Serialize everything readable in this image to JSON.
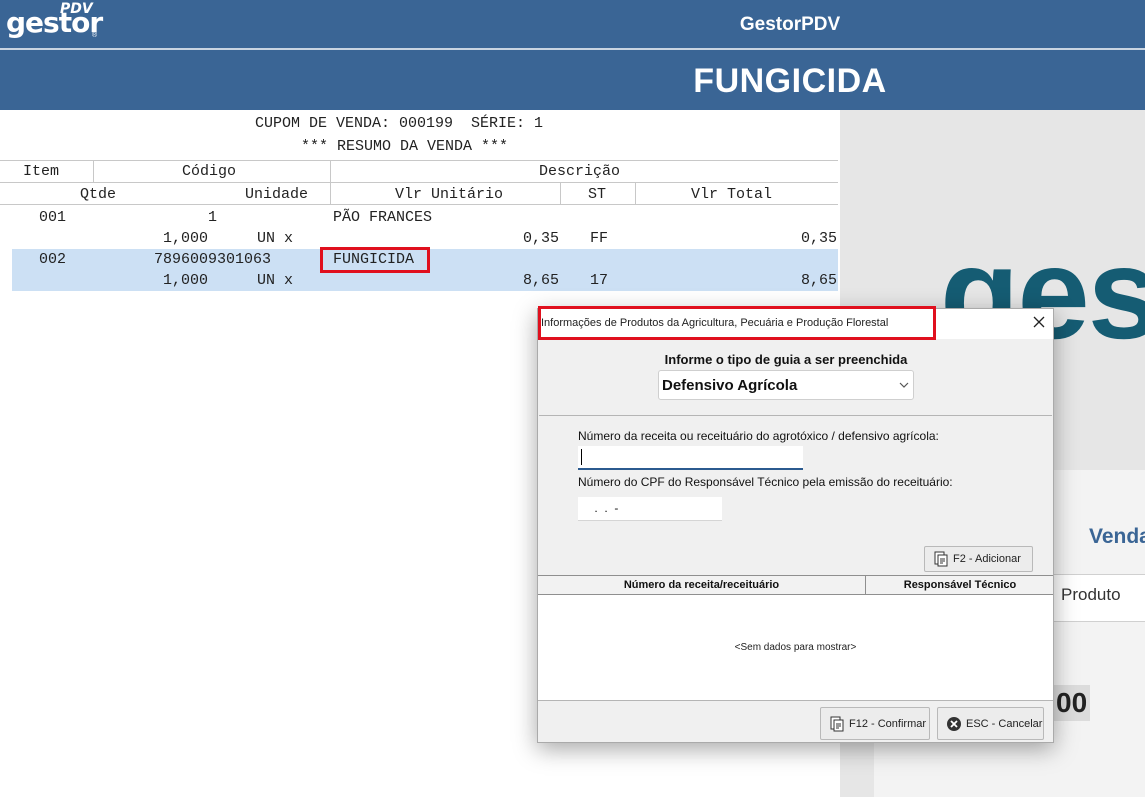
{
  "header": {
    "logo_text": "gestor",
    "logo_sub": "PDV",
    "app_title": "GestorPDV",
    "product_title": "FUNGICIDA"
  },
  "receipt": {
    "line1": "CUPOM DE VENDA: 000199  SÉRIE: 1",
    "line2": "*** RESUMO DA VENDA ***",
    "col_item": "Item",
    "col_codigo": "Código",
    "col_descricao": "Descrição",
    "col_qtde": "Qtde",
    "col_unidade": "Unidade",
    "col_vlr_unitario": "Vlr Unitário",
    "col_st": "ST",
    "col_vlr_total": "Vlr Total",
    "items": [
      {
        "item": "001",
        "codigo": "1",
        "descricao": "PÃO FRANCES",
        "qtde": "1,000",
        "unidade": "UN x",
        "vlr_unitario": "0,35",
        "st": "FF",
        "vlr_total": "0,35"
      },
      {
        "item": "002",
        "codigo": "7896009301063",
        "descricao": "FUNGICIDA",
        "qtde": "1,000",
        "unidade": "UN x",
        "vlr_unitario": "8,65",
        "st": "17",
        "vlr_total": "8,65"
      }
    ]
  },
  "right_panel": {
    "logo_text": "ges",
    "venda_label": "Venda",
    "produto_label": "Produto",
    "total_fragment": "00"
  },
  "dialog": {
    "title": "Informações de Produtos da Agricultura, Pecuária e Produção Florestal",
    "guide_prompt": "Informe o tipo de guia a ser preenchida",
    "guide_selected": "Defensivo Agrícola",
    "receita_label": "Número da receita ou receituário do agrotóxico / defensivo agrícola:",
    "receita_value": "",
    "cpf_label": "Número do CPF do Responsável Técnico pela emissão do receituário:",
    "cpf_mask": " .  .  -",
    "add_button": "F2 - Adicionar",
    "grid_col1": "Número da receita/receituário",
    "grid_col2": "Responsável Técnico",
    "grid_empty": "<Sem dados para mostrar>",
    "confirm_button": "F12 - Confirmar",
    "cancel_button": "ESC - Cancelar"
  },
  "colors": {
    "header_blue": "#3a6595",
    "highlight_red": "#e0101e",
    "selected_row": "#cce0f4",
    "brand_teal": "#155c73"
  }
}
